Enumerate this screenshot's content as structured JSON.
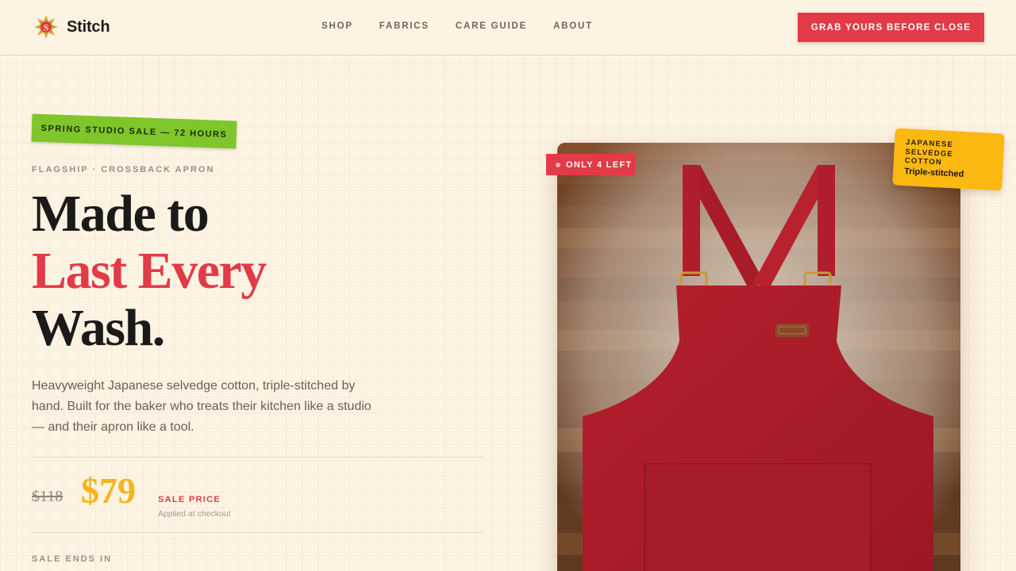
{
  "header": {
    "brand": "Stitch",
    "nav": [
      "SHOP",
      "FABRICS",
      "CARE GUIDE",
      "ABOUT"
    ],
    "cta": "GRAB YOURS BEFORE CLOSE"
  },
  "hero": {
    "sticker": "SPRING STUDIO SALE — 72 HOURS",
    "eyebrow": "FLAGSHIP · CROSSBACK APRON",
    "headline": {
      "line1": "Made to",
      "line2": "Last Every",
      "line3": "Wash."
    },
    "description": "Heavyweight Japanese selvedge cotton, triple-stitched by hand. Built for the baker who treats their kitchen like a studio — and their apron like a tool.",
    "price": {
      "old": "$118",
      "new": "$79",
      "label": "SALE PRICE",
      "note": "Applied at checkout"
    },
    "countdown_label": "SALE ENDS IN"
  },
  "product": {
    "stock_badge": "ONLY 4 LEFT",
    "fabric_badge": {
      "lines": [
        "JAPANESE",
        "SELVEDGE",
        "COTTON"
      ],
      "emphasis": "Triple-stitched"
    },
    "image_icon": "crossback-apron-photo"
  },
  "colors": {
    "accent_red": "#e23a47",
    "price_gold": "#f2b51c",
    "sticker_green": "#7ec62a",
    "badge_yellow": "#fbb811",
    "background": "#fdf3e3"
  }
}
